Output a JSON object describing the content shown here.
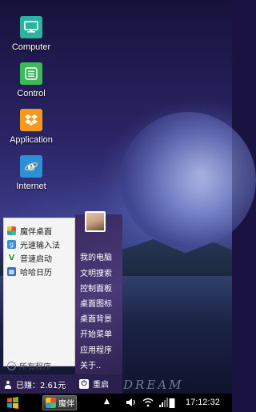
{
  "desktop": {
    "icons": [
      {
        "label": "Computer",
        "icon": "monitor-icon",
        "color": "#2bb3a0"
      },
      {
        "label": "Control",
        "icon": "list-icon",
        "color": "#3cba5a"
      },
      {
        "label": "Application",
        "icon": "dropbox-icon",
        "color": "#f39a1d"
      },
      {
        "label": "Internet",
        "icon": "internet-explorer-icon",
        "color": "#2d8fd6"
      }
    ],
    "watermark": "DREAM"
  },
  "start_menu": {
    "left_items": [
      {
        "label": "魔伴桌面",
        "icon": "pinwheel-icon"
      },
      {
        "label": "光速输入法",
        "icon": "keyboard-g-icon"
      },
      {
        "label": "音速启动",
        "icon": "v-icon"
      },
      {
        "label": "哈哈日历",
        "icon": "calendar-icon"
      }
    ],
    "all_programs": "所有程序",
    "right_items": [
      "我的电脑",
      "文明搜索",
      "控制面板",
      "桌面图标",
      "桌面背景",
      "开始菜单",
      "应用程序",
      "关于.."
    ],
    "credits": "已赚：2.61元",
    "restart": "重启"
  },
  "taskbar": {
    "app_label": "魔伴",
    "clock": "17:12:32"
  },
  "colors": {
    "menu_right_bg": "#3a2a60",
    "taskbar_bg": "#000000"
  }
}
